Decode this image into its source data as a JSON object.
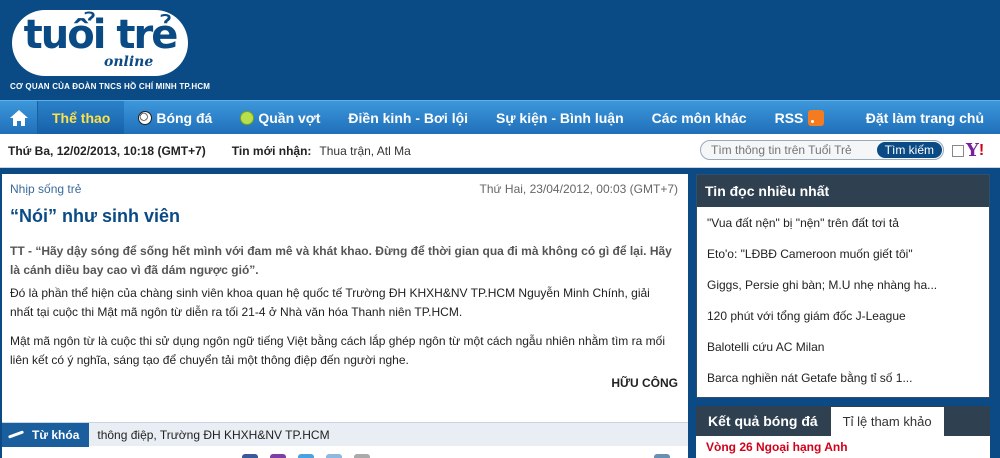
{
  "header": {
    "logo_text": "tuổi trẻ",
    "logo_online": "online",
    "logo_sub": "CƠ QUAN CỦA ĐOÀN TNCS HỒ CHÍ MINH TP.HCM"
  },
  "nav": {
    "items": [
      {
        "label": "Thể thao"
      },
      {
        "label": "Bóng đá"
      },
      {
        "label": "Quần vợt"
      },
      {
        "label": "Điền kinh - Bơi lội"
      },
      {
        "label": "Sự kiện - Bình luận"
      },
      {
        "label": "Các môn khác"
      },
      {
        "label": "RSS"
      }
    ],
    "homepage_label": "Đặt làm trang chủ"
  },
  "infobar": {
    "date": "Thứ Ba, 12/02/2013, 10:18 (GMT+7)",
    "news_label": "Tin mới nhận:",
    "news_text": "Thua trận, Atl Ma",
    "search_placeholder": "Tìm thông tin trên Tuổi Trẻ",
    "search_button": "Tìm kiếm"
  },
  "article": {
    "section": "Nhịp sống trẻ",
    "date": "Thứ Hai, 23/04/2012, 00:03 (GMT+7)",
    "title": "“Nói” như sinh viên",
    "lead": "TT - “Hãy dậy sóng để sống hết mình với đam mê và khát khao. Đừng để thời gian qua đi mà không có gì để lại. Hãy là cánh diều bay cao vì đã dám ngược gió”.",
    "p1": "Đó là phần thể hiện của chàng sinh viên khoa quan hệ quốc tế Trường ĐH KHXH&NV TP.HCM Nguyễn Minh Chính, giải nhất tại cuộc thi Mật mã ngôn từ diễn ra tối 21-4 ở Nhà văn hóa Thanh niên TP.HCM.",
    "p2": "Mật mã ngôn từ là cuộc thi sử dụng ngôn ngữ tiếng Việt bằng cách lắp ghép ngôn từ một cách ngẫu nhiên nhằm tìm ra mối liên kết có ý nghĩa, sáng tạo để chuyển tải một thông điệp đến người nghe.",
    "author": "HỮU CÔNG"
  },
  "keywords": {
    "label": "Từ khóa",
    "text": "thông điệp, Trường ĐH KHXH&NV TP.HCM"
  },
  "most_read": {
    "title": "Tin đọc nhiều nhất",
    "items": [
      "\"Vua đất nện\" bị \"nện\" trên đất tơi tả",
      "Eto'o: \"LĐBĐ Cameroon muốn giết tôi\"",
      "Giggs, Persie ghi bàn; M.U nhẹ nhàng ha...",
      "120 phút với tổng giám đốc J-League",
      "Balotelli cứu AC Milan",
      "Barca nghiền nát Getafe bằng tỉ số 1..."
    ]
  },
  "scores": {
    "tab_active": "Kết quả bóng đá",
    "tab_inactive": "Tỉ lệ tham khảo",
    "first_line": "Vòng 26 Ngoại hạng Anh"
  }
}
